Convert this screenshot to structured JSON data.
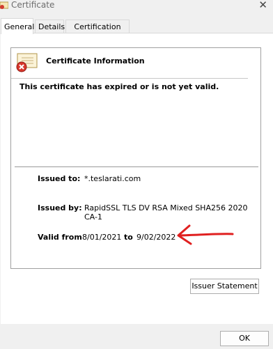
{
  "window": {
    "title": "Certificate",
    "close_glyph": "✕"
  },
  "tabs": [
    {
      "label": "General",
      "active": true
    },
    {
      "label": "Details",
      "active": false
    },
    {
      "label": "Certification Path",
      "active": false
    }
  ],
  "info": {
    "heading": "Certificate Information",
    "status_message": "This certificate has expired or is not yet valid.",
    "icon": "certificate-invalid-icon"
  },
  "fields": {
    "issued_to_label": "Issued to:",
    "issued_to_value": "*.teslarati.com",
    "issued_by_label": "Issued by:",
    "issued_by_value": "RapidSSL TLS DV RSA Mixed SHA256 2020 CA-1",
    "valid_from_label": "Valid from",
    "valid_from_value": "8/01/2021",
    "valid_to_label": "to",
    "valid_to_value": "9/02/2022"
  },
  "buttons": {
    "issuer_statement": "Issuer Statement",
    "ok": "OK"
  },
  "colors": {
    "annotation_arrow": "#e02020",
    "panel_border": "#a0a0a0",
    "window_bg": "#f0f0f0"
  }
}
